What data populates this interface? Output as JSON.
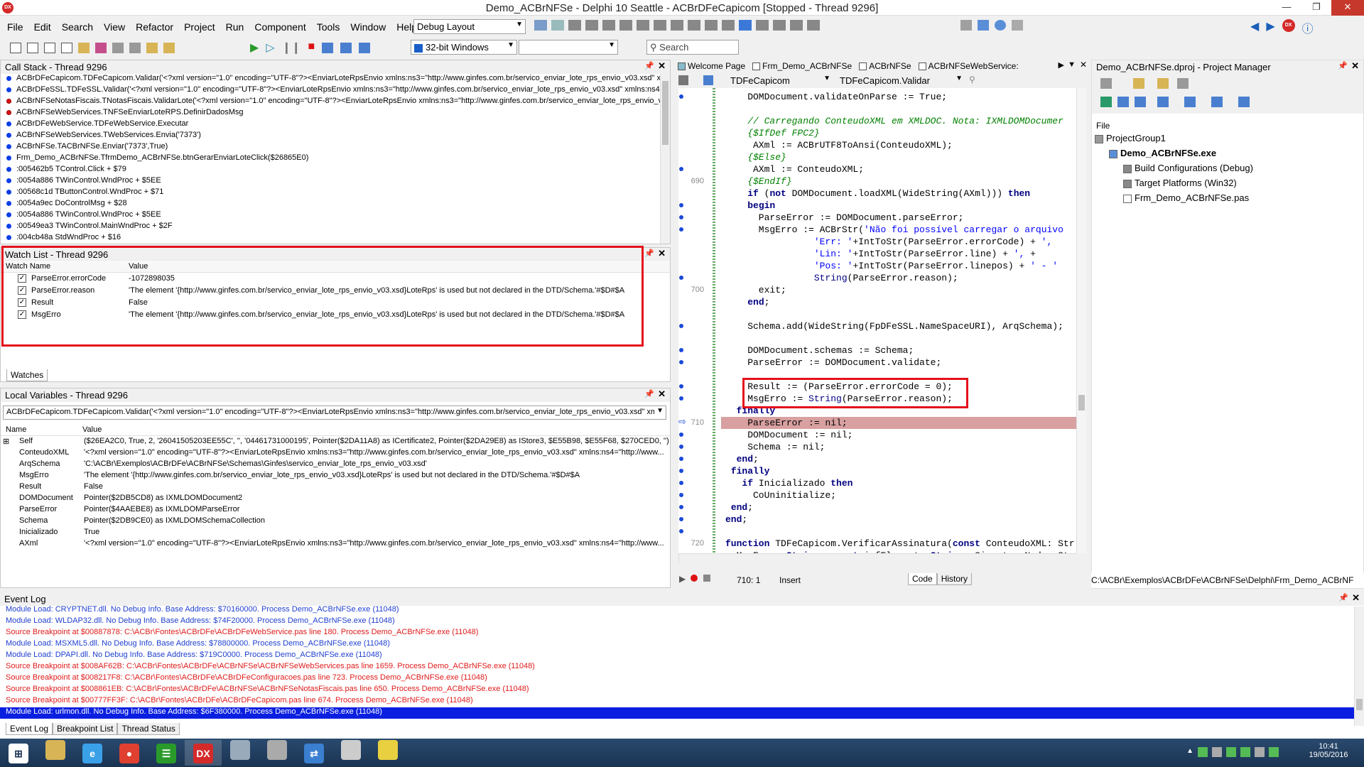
{
  "window": {
    "title": "Demo_ACBrNFSe - Delphi 10 Seattle - ACBrDFeCapicom [Stopped - Thread 9296]",
    "logo": "DX"
  },
  "menu": [
    "File",
    "Edit",
    "Search",
    "View",
    "Refactor",
    "Project",
    "Run",
    "Component",
    "Tools",
    "Window",
    "Help"
  ],
  "layout_combo": "Debug Layout",
  "platform_combo": "32-bit Windows",
  "search_placeholder": "Search",
  "callstack": {
    "title": "Call Stack - Thread 9296",
    "rows": [
      {
        "t": "ACBrDFeCapicom.TDFeCapicom.Validar('<?xml version=\"1.0\" encoding=\"UTF-8\"?><EnviarLoteRpsEnvio xmlns:ns3=\"http://www.ginfes.com.br/servico_enviar_lote_rps_envio_v03.xsd\" x",
        "e": false
      },
      {
        "t": "ACBrDFeSSL.TDFeSSL.Validar('<?xml version=\"1.0\" encoding=\"UTF-8\"?><EnviarLoteRpsEnvio xmlns:ns3=\"http://www.ginfes.com.br/servico_enviar_lote_rps_envio_v03.xsd\" xmlns:ns4",
        "e": false
      },
      {
        "t": "ACBrNFSeNotasFiscais.TNotasFiscais.ValidarLote('<?xml version=\"1.0\" encoding=\"UTF-8\"?><EnviarLoteRpsEnvio xmlns:ns3=\"http://www.ginfes.com.br/servico_enviar_lote_rps_envio_v",
        "e": true
      },
      {
        "t": "ACBrNFSeWebServices.TNFSeEnviarLoteRPS.DefinirDadosMsg",
        "e": true
      },
      {
        "t": "ACBrDFeWebService.TDFeWebService.Executar",
        "e": false
      },
      {
        "t": "ACBrNFSeWebServices.TWebServices.Envia('7373')",
        "e": false
      },
      {
        "t": "ACBrNFSe.TACBrNFSe.Enviar('7373',True)",
        "e": false
      },
      {
        "t": "Frm_Demo_ACBrNFSe.TfrmDemo_ACBrNFSe.btnGerarEnviarLoteClick($26865E0)",
        "e": false
      },
      {
        "t": ":005462b5 TControl.Click + $79",
        "e": false
      },
      {
        "t": ":0054a886 TWinControl.WndProc + $5EE",
        "e": false
      },
      {
        "t": ":00568c1d TButtonControl.WndProc + $71",
        "e": false
      },
      {
        "t": ":0054a9ec DoControlMsg + $28",
        "e": false
      },
      {
        "t": ":0054a886 TWinControl.WndProc + $5EE",
        "e": false
      },
      {
        "t": ":00549ea3 TWinControl.MainWndProc + $2F",
        "e": false
      },
      {
        "t": ":004cb48a StdWndProc + $16",
        "e": false
      }
    ]
  },
  "watch": {
    "title": "Watch List - Thread 9296",
    "col_name": "Watch Name",
    "col_value": "Value",
    "tab": "Watches",
    "rows": [
      {
        "n": "ParseError.errorCode",
        "v": "-1072898035"
      },
      {
        "n": "ParseError.reason",
        "v": "'The element '{http://www.ginfes.com.br/servico_enviar_lote_rps_envio_v03.xsd}LoteRps' is used but not declared in the DTD/Schema.'#$D#$A"
      },
      {
        "n": "Result",
        "v": "False"
      },
      {
        "n": "MsgErro",
        "v": "'The element '{http://www.ginfes.com.br/servico_enviar_lote_rps_envio_v03.xsd}LoteRps' is used but not declared in the DTD/Schema.'#$D#$A"
      }
    ]
  },
  "locals": {
    "title": "Local Variables - Thread 9296",
    "frame": "ACBrDFeCapicom.TDFeCapicom.Validar('<?xml version=\"1.0\" encoding=\"UTF-8\"?><EnviarLoteRpsEnvio xmlns:ns3=\"http://www.ginfes.com.br/servico_enviar_lote_rps_envio_v03.xsd\" xmln",
    "col_name": "Name",
    "col_value": "Value",
    "rows": [
      {
        "n": "Self",
        "v": "($26EA2C0, True, 2, '26041505203EE55C', '', '04461731000195', Pointer($2DA11A8) as ICertificate2, Pointer($2DA29E8) as IStore3, $E55B98, $E55F68, $270CED0, '')"
      },
      {
        "n": "ConteudoXML",
        "v": "'<?xml version=\"1.0\" encoding=\"UTF-8\"?><EnviarLoteRpsEnvio xmlns:ns3=\"http://www.ginfes.com.br/servico_enviar_lote_rps_envio_v03.xsd\" xmlns:ns4=\"http://www..."
      },
      {
        "n": "ArqSchema",
        "v": "'C:\\ACBr\\Exemplos\\ACBrDFe\\ACBrNFSe\\Schemas\\Ginfes\\servico_enviar_lote_rps_envio_v03.xsd'"
      },
      {
        "n": "MsgErro",
        "v": "'The element '{http://www.ginfes.com.br/servico_enviar_lote_rps_envio_v03.xsd}LoteRps' is used but not declared in the DTD/Schema.'#$D#$A"
      },
      {
        "n": "Result",
        "v": "False"
      },
      {
        "n": "DOMDocument",
        "v": "Pointer($2DB5CD8) as IXMLDOMDocument2"
      },
      {
        "n": "ParseError",
        "v": "Pointer($4AAEBE8) as IXMLDOMParseError"
      },
      {
        "n": "Schema",
        "v": "Pointer($2DB9CE0) as IXMLDOMSchemaCollection"
      },
      {
        "n": "Inicializado",
        "v": "True"
      },
      {
        "n": "AXml",
        "v": "'<?xml version=\"1.0\" encoding=\"UTF-8\"?><EnviarLoteRpsEnvio xmlns:ns3=\"http://www.ginfes.com.br/servico_enviar_lote_rps_envio_v03.xsd\" xmlns:ns4=\"http://www..."
      }
    ]
  },
  "editor": {
    "tabs": [
      "Welcome Page",
      "Frm_Demo_ACBrNFSe",
      "ACBrNFSe",
      "ACBrNFSeWebService:"
    ],
    "class_combo": "TDFeCapicom",
    "method_combo": "TDFeCapicom.Validar",
    "status_pos": "710:  1",
    "status_mode": "Insert",
    "bottom_tabs": [
      "Code",
      "History"
    ],
    "line_nums": [
      "690",
      "700",
      "710",
      "720"
    ]
  },
  "project": {
    "title": "Demo_ACBrNFSe.dproj - Project Manager",
    "file_label": "File",
    "items": [
      "ProjectGroup1",
      "Demo_ACBrNFSe.exe",
      "Build Configurations (Debug)",
      "Target Platforms (Win32)",
      "Frm_Demo_ACBrNFSe.pas"
    ],
    "path": "C:\\ACBr\\Exemplos\\ACBrDFe\\ACBrNFSe\\Delphi\\Frm_Demo_ACBrNF"
  },
  "eventlog": {
    "title": "Event Log",
    "tabs": [
      "Event Log",
      "Breakpoint List",
      "Thread Status"
    ],
    "rows": [
      {
        "t": "Module Load: CRYPTNET.dll. No Debug Info. Base Address: $70160000. Process Demo_ACBrNFSe.exe (11048)",
        "c": "blue"
      },
      {
        "t": "Module Load: WLDAP32.dll. No Debug Info. Base Address: $74F20000. Process Demo_ACBrNFSe.exe (11048)",
        "c": "blue"
      },
      {
        "t": "Source Breakpoint at $00887878: C:\\ACBr\\Fontes\\ACBrDFe\\ACBrDFeWebService.pas line 180. Process Demo_ACBrNFSe.exe (11048)",
        "c": "red"
      },
      {
        "t": "Module Load: MSXML5.dll. No Debug Info. Base Address: $78800000. Process Demo_ACBrNFSe.exe (11048)",
        "c": "blue"
      },
      {
        "t": "Module Load: DPAPI.dll. No Debug Info. Base Address: $719C0000. Process Demo_ACBrNFSe.exe (11048)",
        "c": "blue"
      },
      {
        "t": "Source Breakpoint at $008AF62B: C:\\ACBr\\Fontes\\ACBrDFe\\ACBrNFSe\\ACBrNFSeWebServices.pas line 1659. Process Demo_ACBrNFSe.exe (11048)",
        "c": "red"
      },
      {
        "t": "Source Breakpoint at $008217F8: C:\\ACBr\\Fontes\\ACBrDFe\\ACBrDFeConfiguracoes.pas line 723. Process Demo_ACBrNFSe.exe (11048)",
        "c": "red"
      },
      {
        "t": "Source Breakpoint at $008861EB: C:\\ACBr\\Fontes\\ACBrDFe\\ACBrNFSe\\ACBrNFSeNotasFiscais.pas line 650. Process Demo_ACBrNFSe.exe (11048)",
        "c": "red"
      },
      {
        "t": "Source Breakpoint at $00777FF3F: C:\\ACBr\\Fontes\\ACBrDFe\\ACBrDFeCapicom.pas line 674. Process Demo_ACBrNFSe.exe (11048)",
        "c": "red"
      },
      {
        "t": "Module Load: urlmon.dll. No Debug Info. Base Address: $6F380000. Process Demo_ACBrNFSe.exe (11048)",
        "c": "sel"
      }
    ]
  },
  "taskbar": {
    "time": "10:41",
    "date": "19/05/2016",
    "items": [
      "start-icon",
      "explorer-icon",
      "ie-icon",
      "chrome-icon",
      "tool-icon",
      "delphi-dx-icon",
      "notepad-icon",
      "app-icon",
      "teamviewer-icon",
      "paint-icon",
      "delphi7-icon"
    ]
  }
}
